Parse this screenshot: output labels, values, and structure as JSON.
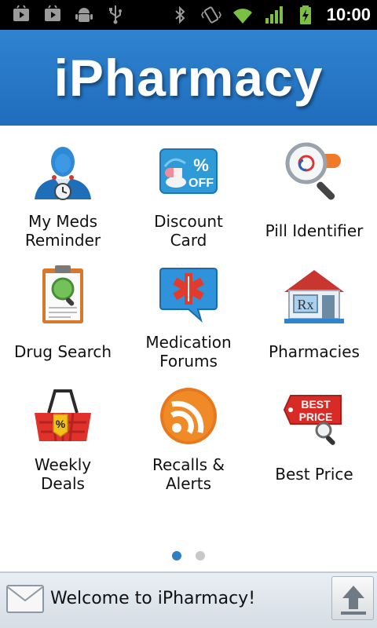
{
  "status_bar": {
    "time": "10:00",
    "left_icons": [
      "play-store-icon",
      "play-store-icon",
      "android-debug-icon",
      "usb-icon"
    ],
    "right_icons": [
      "bluetooth-icon",
      "vibrate-icon",
      "wifi-icon",
      "signal-icon",
      "battery-charging-icon"
    ]
  },
  "header": {
    "title": "iPharmacy",
    "color": "#2373c4"
  },
  "tiles": [
    {
      "label": "My Meds\nReminder",
      "icon": "doctor-clock-icon"
    },
    {
      "label": "Discount\nCard",
      "icon": "discount-card-icon"
    },
    {
      "label": "Pill Identifier",
      "icon": "pill-magnifier-icon"
    },
    {
      "label": "Drug Search",
      "icon": "clipboard-search-icon"
    },
    {
      "label": "Medication\nForums",
      "icon": "medical-chat-icon"
    },
    {
      "label": "Pharmacies",
      "icon": "rx-store-icon"
    },
    {
      "label": "Weekly\nDeals",
      "icon": "basket-icon"
    },
    {
      "label": "Recalls &\nAlerts",
      "icon": "rss-icon"
    },
    {
      "label": "Best Price",
      "icon": "best-price-tag-icon"
    }
  ],
  "pager": {
    "pages": 2,
    "current": 1,
    "active_color": "#2f7fc4",
    "inactive_color": "#c8c8c8"
  },
  "bottom_bar": {
    "message": "Welcome to iPharmacy!"
  }
}
